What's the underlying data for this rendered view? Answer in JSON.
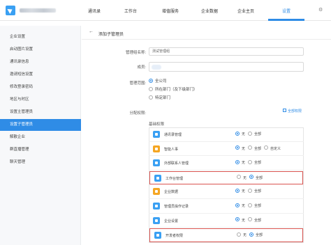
{
  "nav": {
    "items": [
      {
        "label": "通讯录"
      },
      {
        "label": "工作台"
      },
      {
        "label": "增值服务"
      },
      {
        "label": "企业数据"
      },
      {
        "label": "企业主页"
      },
      {
        "label": "设置"
      }
    ],
    "active_index": 5,
    "accent_color": "#2f8ce6"
  },
  "sidebar": {
    "items": [
      {
        "label": "企业设置"
      },
      {
        "label": "启动图片设置"
      },
      {
        "label": "通讯录信息"
      },
      {
        "label": "邀请短信设置"
      },
      {
        "label": "修改登录密码"
      },
      {
        "label": "地区与时区"
      },
      {
        "label": "设置主管理员"
      },
      {
        "label": "设置子管理员"
      },
      {
        "label": "解散企业"
      },
      {
        "label": "群直播管理"
      },
      {
        "label": "聊天管理"
      }
    ],
    "active_index": 7
  },
  "page": {
    "back_icon": "arrow-left-icon",
    "title": "添加子管理员"
  },
  "form": {
    "group_name_label": "管理组名称:",
    "group_name_value": "测试管理组",
    "members_label": "成员:",
    "scope_label": "管理范围:",
    "scope_options": [
      {
        "label": "全公司",
        "selected": true
      },
      {
        "label": "所在部门（及下级部门）",
        "selected": false
      },
      {
        "label": "特定部门",
        "selected": false
      }
    ],
    "permission_label": "分配权限:",
    "permission_hint": "全部权限",
    "basic_permissions_title": "基础权限"
  },
  "permissions": [
    {
      "name": "通讯录管理",
      "icon": "contacts-icon",
      "color": "#3aa0f3",
      "options": [
        "无",
        "全部"
      ],
      "selected": 0,
      "highlight": false
    },
    {
      "name": "智能人事",
      "icon": "hr-icon",
      "color": "#f5a623",
      "options": [
        "无",
        "全部",
        "自定义"
      ],
      "selected": 0,
      "highlight": false
    },
    {
      "name": "外部联系人管理",
      "icon": "external-contact-icon",
      "color": "#3aa0f3",
      "options": [
        "无",
        "全部"
      ],
      "selected": 0,
      "highlight": false
    },
    {
      "name": "工作台管理",
      "icon": "workbench-icon",
      "color": "#3aa0f3",
      "options": [
        "无",
        "全部"
      ],
      "selected": 1,
      "highlight": true
    },
    {
      "name": "企业数据",
      "icon": "data-icon",
      "color": "#f5a623",
      "options": [
        "无",
        "全部"
      ],
      "selected": 0,
      "highlight": false
    },
    {
      "name": "管理员操作记录",
      "icon": "log-icon",
      "color": "#3aa0f3",
      "options": [
        "无",
        "全部"
      ],
      "selected": 0,
      "highlight": false
    },
    {
      "name": "企业设置",
      "icon": "settings-icon",
      "color": "#3aa0f3",
      "options": [
        "无",
        "全部"
      ],
      "selected": 0,
      "highlight": false
    },
    {
      "name": "开发者权限",
      "icon": "developer-icon",
      "color": "#3aa0f3",
      "options": [
        "无",
        "全部"
      ],
      "selected": 1,
      "highlight": true
    }
  ]
}
